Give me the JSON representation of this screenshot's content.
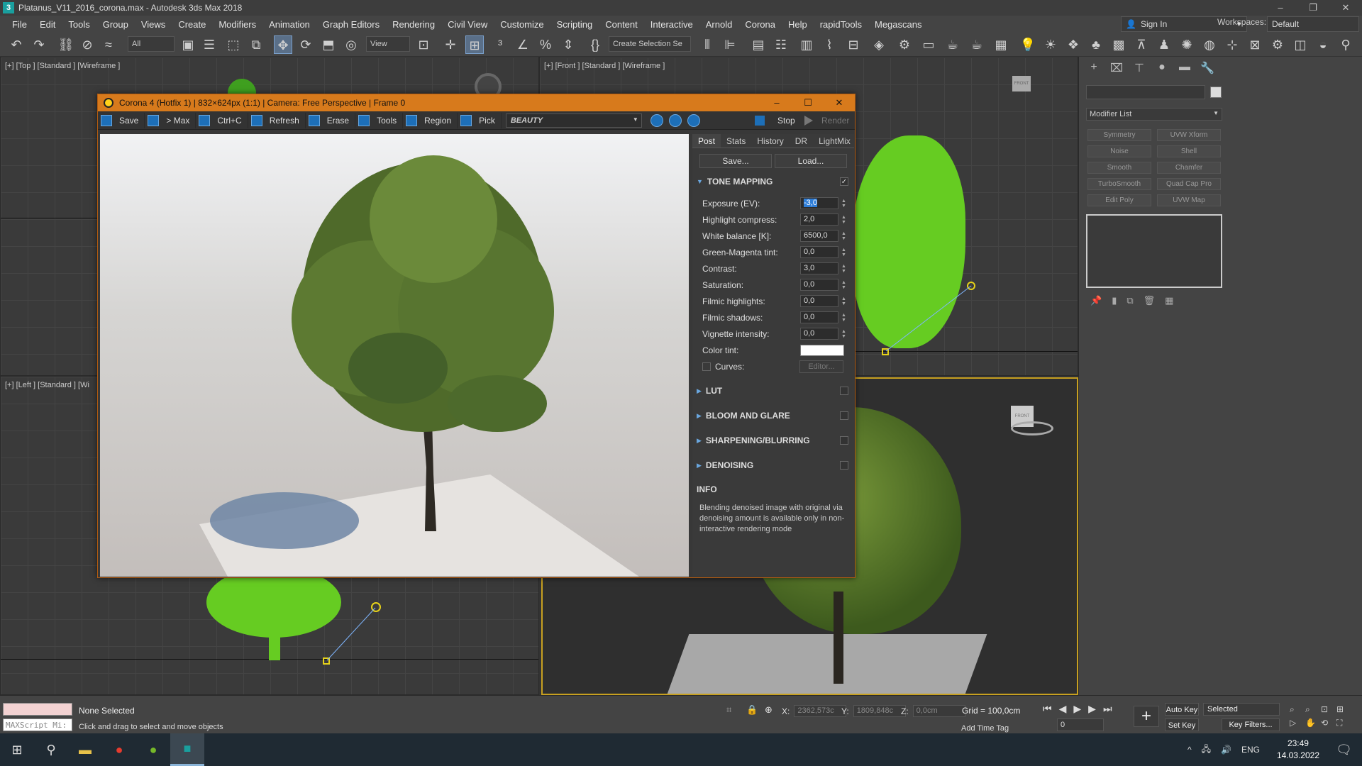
{
  "window": {
    "title": "Platanus_V11_2016_corona.max - Autodesk 3ds Max 2018"
  },
  "menu": [
    "File",
    "Edit",
    "Tools",
    "Group",
    "Views",
    "Create",
    "Modifiers",
    "Animation",
    "Graph Editors",
    "Rendering",
    "Civil View",
    "Customize",
    "Scripting",
    "Content",
    "Interactive",
    "Arnold",
    "Corona",
    "Help",
    "rapidTools",
    "Megascans"
  ],
  "account": {
    "signin": "Sign In",
    "workspaces_label": "Workspaces:",
    "workspace": "Default"
  },
  "toolbar": {
    "filter": "All",
    "refcoord": "View",
    "selection_set": "Create Selection Se"
  },
  "viewports": {
    "top": "[+] [Top ] [Standard ] [Wireframe ]",
    "front": "[+] [Front ] [Standard ] [Wireframe ]",
    "left": "[+] [Left ] [Standard ] [Wi"
  },
  "vfb": {
    "title": "Corona 4 (Hotfix 1) | 832×624px (1:1) | Camera: Free Perspective | Frame 0",
    "buttons": [
      "Save",
      "> Max",
      "Ctrl+C",
      "Refresh",
      "Erase",
      "Tools",
      "Region",
      "Pick"
    ],
    "channel": "BEAUTY",
    "stop": "Stop",
    "render": "Render",
    "tabs": [
      "Post",
      "Stats",
      "History",
      "DR",
      "LightMix"
    ],
    "save_btn": "Save...",
    "load_btn": "Load...",
    "tone_mapping": "TONE MAPPING",
    "params": [
      {
        "label": "Exposure (EV):",
        "value": "-3,0"
      },
      {
        "label": "Highlight compress:",
        "value": "2,0"
      },
      {
        "label": "White balance [K]:",
        "value": "6500,0"
      },
      {
        "label": "Green-Magenta tint:",
        "value": "0,0"
      },
      {
        "label": "Contrast:",
        "value": "3,0"
      },
      {
        "label": "Saturation:",
        "value": "0,0"
      },
      {
        "label": "Filmic highlights:",
        "value": "0,0"
      },
      {
        "label": "Filmic shadows:",
        "value": "0,0"
      },
      {
        "label": "Vignette intensity:",
        "value": "0,0"
      }
    ],
    "color_tint": "Color tint:",
    "curves": "Curves:",
    "editor": "Editor...",
    "sections": [
      "LUT",
      "BLOOM AND GLARE",
      "SHARPENING/BLURRING",
      "DENOISING"
    ],
    "info_title": "INFO",
    "info_text": "Blending denoised image with original via denoising amount is available only in non-interactive rendering mode"
  },
  "cmdpanel": {
    "modifier_list": "Modifier List",
    "mods": [
      "Symmetry",
      "UVW Xform",
      "Noise",
      "Shell",
      "Smooth",
      "Chamfer",
      "TurboSmooth",
      "Quad Cap Pro",
      "Edit Poly",
      "UVW Map"
    ]
  },
  "status": {
    "maxscript": "MAXScript Mi:",
    "selection": "None Selected",
    "hint": "Click and drag to select and move objects",
    "x_label": "X:",
    "x": "2362,573c",
    "y_label": "Y:",
    "y": "1809,848c",
    "z_label": "Z:",
    "z": "0,0cm",
    "grid": "Grid = 100,0cm",
    "add_time_tag": "Add Time Tag",
    "frame": "0",
    "auto_key": "Auto Key",
    "set_key": "Set Key",
    "selected": "Selected",
    "key_filters": "Key Filters..."
  },
  "taskbar": {
    "lang": "ENG",
    "time": "23:49",
    "date": "14.03.2022"
  }
}
